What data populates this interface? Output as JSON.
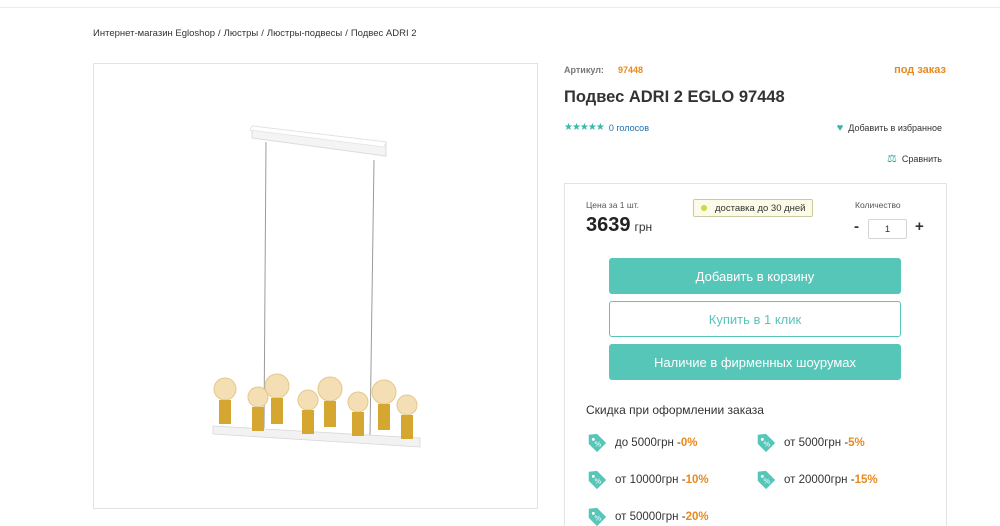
{
  "breadcrumb": [
    {
      "label": "Интернет-магазин Egloshop"
    },
    {
      "label": "Люстры"
    },
    {
      "label": "Люстры-подвесы"
    },
    {
      "label": "Подвес ADRI 2"
    }
  ],
  "breadcrumb_separator": "/",
  "product": {
    "article_label": "Артикул:",
    "article_code": "97448",
    "status": "под заказ",
    "title": "Подвес ADRI 2 EGLO 97448",
    "votes": "0 голосов",
    "favorite_label": "Добавить в избранное",
    "compare_label": "Сравнить",
    "image_alt_icon": "pendant-lamp-image"
  },
  "buy": {
    "price_caption": "Цена за 1 шт.",
    "price_value": "3639",
    "price_unit": "грн",
    "delivery": "доставка до 30 дней",
    "qty_caption": "Количество",
    "qty_minus": "-",
    "qty_value": "1",
    "qty_plus": "+",
    "add_to_cart": "Добавить в корзину",
    "one_click": "Купить в 1 клик",
    "showroom": "Наличие в фирменных шоурумах"
  },
  "discounts": {
    "title": "Скидка при оформлении заказа",
    "items": [
      {
        "text": "до 5000грн - ",
        "percent": "0%"
      },
      {
        "text": "от 5000грн - ",
        "percent": "5%"
      },
      {
        "text": "от 10000грн - ",
        "percent": "10%"
      },
      {
        "text": "от 20000грн - ",
        "percent": "15%"
      },
      {
        "text": "от 50000грн - ",
        "percent": "20%"
      }
    ]
  },
  "colors": {
    "accent": "#56c6b9",
    "orange": "#e8891e",
    "link": "#1a6fb3"
  }
}
